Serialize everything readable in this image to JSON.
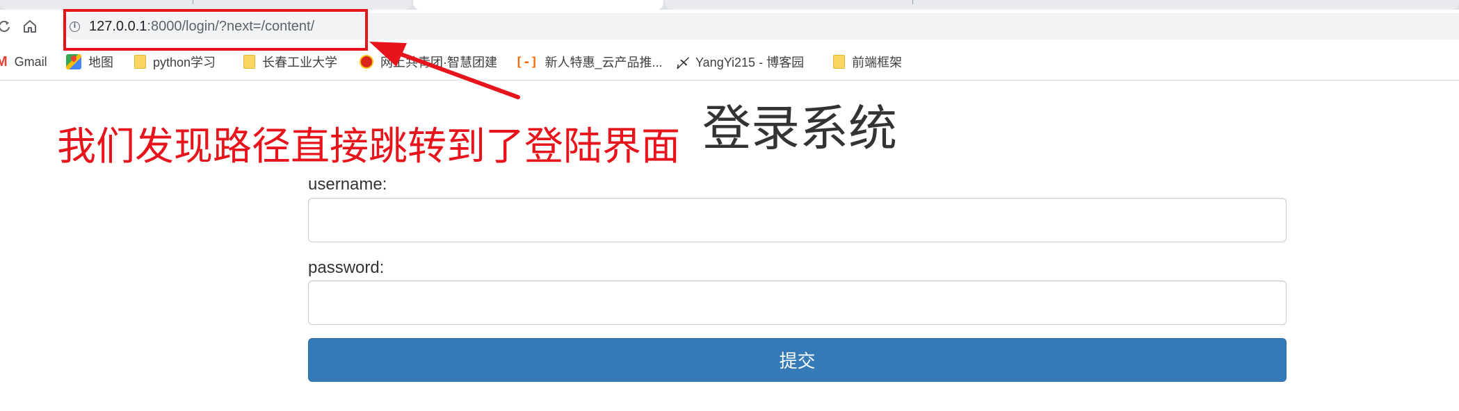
{
  "browser": {
    "url_host": "127.0.0.1",
    "url_path": ":8000/login/?next=/content/",
    "info_glyph": "i",
    "nav_icons": [
      "reload-icon",
      "home-icon",
      "site-info-icon"
    ]
  },
  "bookmarks": [
    {
      "label": "Gmail",
      "icon": "gmail-icon",
      "glyph": "M"
    },
    {
      "label": "地图",
      "icon": "maps-icon"
    },
    {
      "label": "python学习",
      "icon": "folder-icon"
    },
    {
      "label": "长春工业大学",
      "icon": "folder-icon"
    },
    {
      "label": "网上共青团·智慧团建",
      "icon": "party-emblem-icon"
    },
    {
      "label": "新人特惠_云产品推...",
      "icon": "aliyun-icon",
      "glyph": "[-]"
    },
    {
      "label": "YangYi215 - 博客园",
      "icon": "cnblogs-icon",
      "glyph": "〆"
    },
    {
      "label": "前端框架",
      "icon": "folder-icon"
    }
  ],
  "page": {
    "title": "登录系统",
    "username_label": "username:",
    "password_label": "password:",
    "submit_label": "提交"
  },
  "annotation": {
    "text": "我们发现路径直接跳转到了登陆界面",
    "color": "#e8141c"
  },
  "colors": {
    "primary_button": "#337ab7",
    "annotation_red": "#e8141c"
  }
}
